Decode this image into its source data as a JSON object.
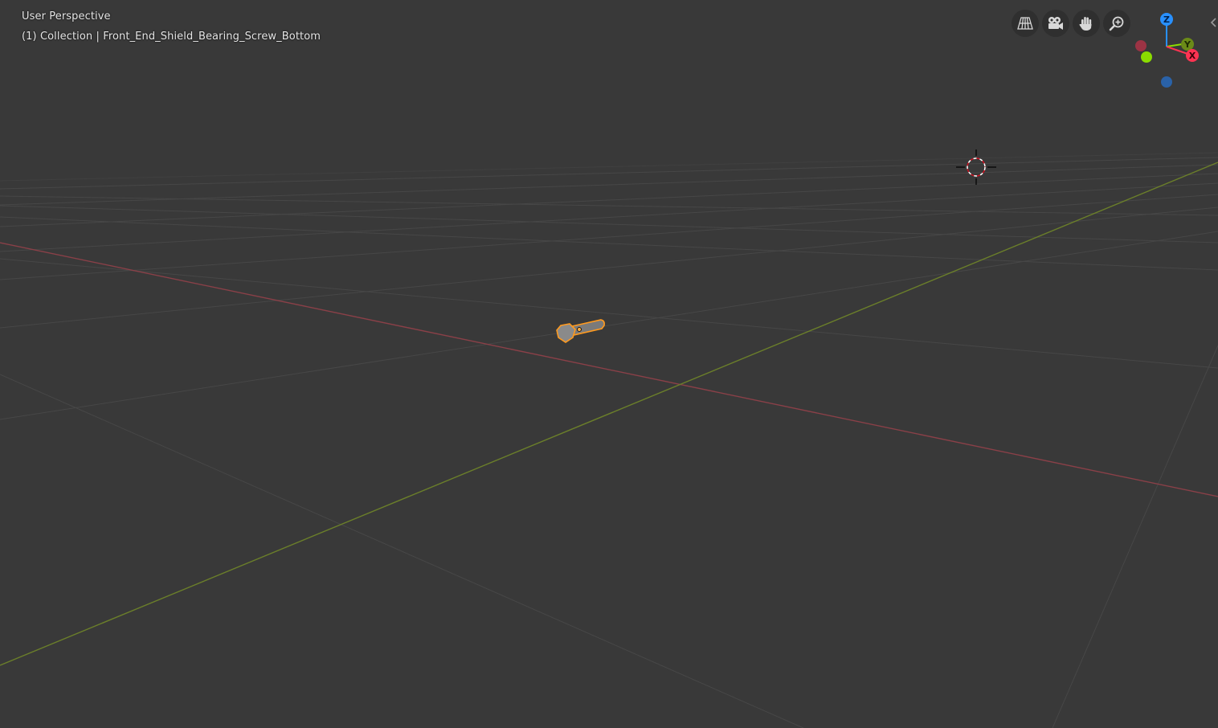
{
  "viewport": {
    "view_name": "User Perspective",
    "object_info": "(1) Collection | Front_End_Shield_Bearing_Screw_Bottom"
  },
  "navigation": {
    "buttons": [
      {
        "name": "toggle-perspective",
        "icon": "grid-perspective-icon"
      },
      {
        "name": "camera-view",
        "icon": "camera-icon"
      },
      {
        "name": "pan-view",
        "icon": "hand-icon"
      },
      {
        "name": "zoom-view",
        "icon": "magnifier-plus-icon"
      }
    ]
  },
  "gizmo": {
    "z_label": "Z",
    "y_label": "Y",
    "x_label": "X",
    "colors": {
      "x": "#ff3352",
      "y": "#8bdc00",
      "z": "#2890ff",
      "x_neg": "#9c3344",
      "z_neg": "#2a62a8"
    }
  },
  "scene_colors": {
    "background": "#393939",
    "grid": "#464646",
    "x_axis": "#8a4048",
    "y_axis": "#6b7f2a",
    "selection": "#ff9a1f"
  }
}
